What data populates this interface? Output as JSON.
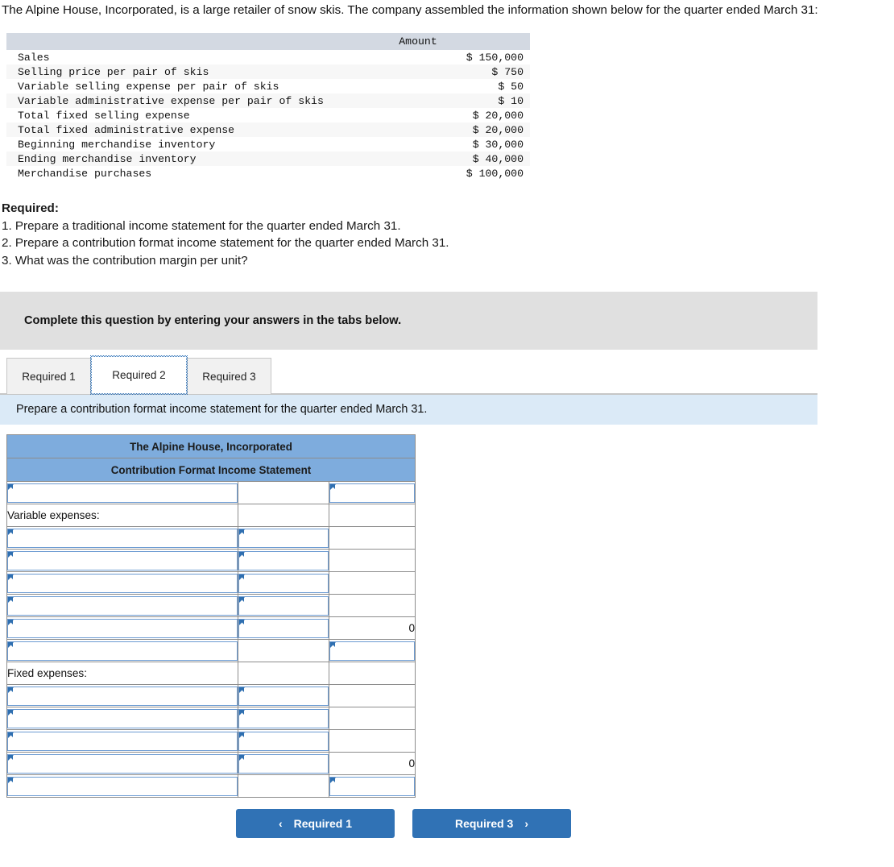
{
  "intro": {
    "paragraph": "The Alpine House, Incorporated, is a large retailer of snow skis. The company assembled the information shown below for the quarter ended March 31:"
  },
  "facts_table": {
    "header": {
      "label": "",
      "amount": "Amount"
    },
    "rows": [
      {
        "label": "Sales",
        "amount": "$ 150,000"
      },
      {
        "label": "Selling price per pair of skis",
        "amount": "$ 750"
      },
      {
        "label": "Variable selling expense per pair of skis",
        "amount": "$ 50"
      },
      {
        "label": "Variable administrative expense per pair of skis",
        "amount": "$ 10"
      },
      {
        "label": "Total fixed selling expense",
        "amount": "$ 20,000"
      },
      {
        "label": "Total fixed administrative expense",
        "amount": "$ 20,000"
      },
      {
        "label": "Beginning merchandise inventory",
        "amount": "$ 30,000"
      },
      {
        "label": "Ending merchandise inventory",
        "amount": "$ 40,000"
      },
      {
        "label": "Merchandise purchases",
        "amount": "$ 100,000"
      }
    ]
  },
  "required": {
    "heading": "Required:",
    "items": [
      "1. Prepare a traditional income statement for the quarter ended March 31.",
      "2. Prepare a contribution format income statement for the quarter ended March 31.",
      "3. What was the contribution margin per unit?"
    ]
  },
  "instruction_bar": {
    "text": "Complete this question by entering your answers in the tabs below."
  },
  "tabs": {
    "items": [
      {
        "label": "Required 1",
        "active": false
      },
      {
        "label": "Required 2",
        "active": true
      },
      {
        "label": "Required 3",
        "active": false
      }
    ]
  },
  "question_bar": {
    "text": "Prepare a contribution format income statement for the quarter ended March 31."
  },
  "answer_grid": {
    "title_line1": "The Alpine House, Incorporated",
    "title_line2": "Contribution Format Income Statement",
    "rows": [
      {
        "c1": {
          "type": "input",
          "value": ""
        },
        "c2": {
          "type": "blank"
        },
        "c3": {
          "type": "input",
          "value": ""
        }
      },
      {
        "c1": {
          "type": "label",
          "value": "Variable expenses:"
        },
        "c2": {
          "type": "blank"
        },
        "c3": {
          "type": "blank"
        }
      },
      {
        "c1": {
          "type": "input",
          "value": ""
        },
        "c2": {
          "type": "input",
          "value": ""
        },
        "c3": {
          "type": "blank"
        }
      },
      {
        "c1": {
          "type": "input",
          "value": ""
        },
        "c2": {
          "type": "input",
          "value": ""
        },
        "c3": {
          "type": "blank"
        }
      },
      {
        "c1": {
          "type": "input",
          "value": ""
        },
        "c2": {
          "type": "input",
          "value": ""
        },
        "c3": {
          "type": "blank"
        }
      },
      {
        "c1": {
          "type": "input",
          "value": ""
        },
        "c2": {
          "type": "input",
          "value": ""
        },
        "c3": {
          "type": "blank"
        }
      },
      {
        "c1": {
          "type": "input",
          "value": ""
        },
        "c2": {
          "type": "input",
          "value": ""
        },
        "c3": {
          "type": "total",
          "value": "0"
        }
      },
      {
        "c1": {
          "type": "input",
          "value": ""
        },
        "c2": {
          "type": "blank"
        },
        "c3": {
          "type": "input",
          "value": ""
        }
      },
      {
        "c1": {
          "type": "label",
          "value": "Fixed expenses:"
        },
        "c2": {
          "type": "blank"
        },
        "c3": {
          "type": "blank"
        }
      },
      {
        "c1": {
          "type": "input",
          "value": ""
        },
        "c2": {
          "type": "input",
          "value": ""
        },
        "c3": {
          "type": "blank"
        }
      },
      {
        "c1": {
          "type": "input",
          "value": ""
        },
        "c2": {
          "type": "input",
          "value": ""
        },
        "c3": {
          "type": "blank"
        }
      },
      {
        "c1": {
          "type": "input",
          "value": ""
        },
        "c2": {
          "type": "input",
          "value": ""
        },
        "c3": {
          "type": "blank"
        }
      },
      {
        "c1": {
          "type": "input",
          "value": ""
        },
        "c2": {
          "type": "input",
          "value": ""
        },
        "c3": {
          "type": "total",
          "value": "0"
        }
      },
      {
        "c1": {
          "type": "input",
          "value": ""
        },
        "c2": {
          "type": "blank"
        },
        "c3": {
          "type": "input",
          "value": "",
          "heavy": true
        }
      }
    ]
  },
  "nav": {
    "prev": {
      "label": "Required 1",
      "icon": "chevron-left-icon",
      "glyph": "‹"
    },
    "next": {
      "label": "Required 3",
      "icon": "chevron-right-icon",
      "glyph": "›"
    }
  },
  "colors": {
    "header_blue": "#7eacdd",
    "banner_grey": "#e0e0e0",
    "banner_blue": "#dbeaf7",
    "button_blue": "#3072b5",
    "input_border": "#6c9bd2",
    "marker_blue": "#2f6fb0"
  }
}
